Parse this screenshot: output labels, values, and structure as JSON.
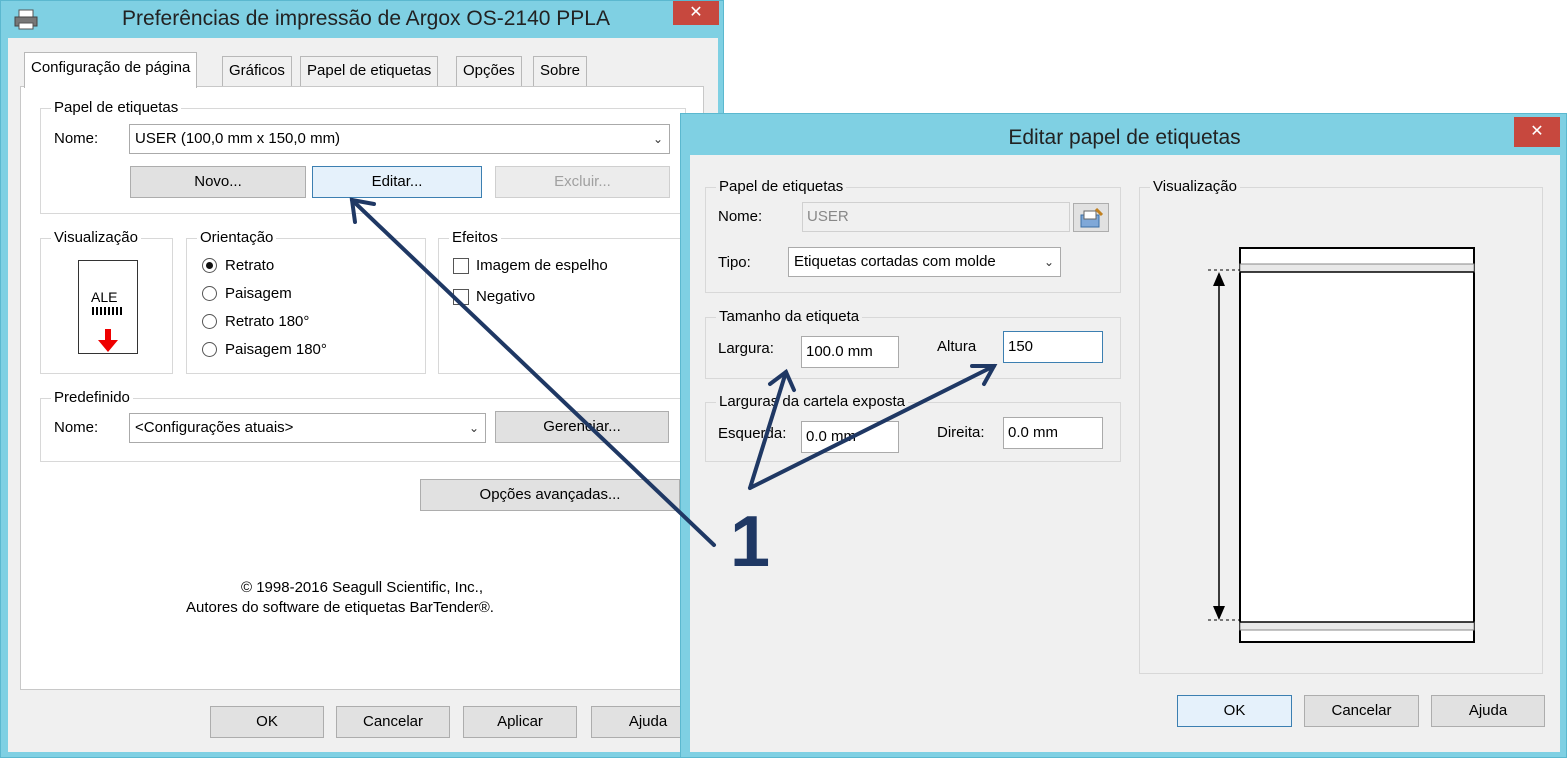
{
  "main_window": {
    "title": "Preferências de impressão de Argox OS-2140 PPLA",
    "close_glyph": "✕",
    "tabs": [
      {
        "label": "Configuração de página",
        "active": true
      },
      {
        "label": "Gráficos"
      },
      {
        "label": "Papel de etiquetas"
      },
      {
        "label": "Opções"
      },
      {
        "label": "Sobre"
      }
    ],
    "paper_group": {
      "label": "Papel de etiquetas",
      "name_label": "Nome:",
      "name_value": "USER (100,0 mm x 150,0 mm)",
      "new_button": "Novo...",
      "edit_button": "Editar...",
      "delete_button": "Excluir..."
    },
    "preview_group": {
      "label": "Visualização",
      "sample_text": "ALE"
    },
    "orientation_group": {
      "label": "Orientação",
      "options": [
        "Retrato",
        "Paisagem",
        "Retrato 180°",
        "Paisagem 180°"
      ],
      "selected": "Retrato"
    },
    "effects_group": {
      "label": "Efeitos",
      "options": [
        "Imagem de espelho",
        "Negativo"
      ]
    },
    "preset_group": {
      "label": "Predefinido",
      "name_label": "Nome:",
      "name_value": "<Configurações atuais>",
      "manage_button": "Gerenciar..."
    },
    "advanced_button": "Opções avançadas...",
    "copyright_line1": "© 1998-2016 Seagull Scientific, Inc.,",
    "copyright_line2": "Autores do software de etiquetas BarTender®.",
    "footer": {
      "ok": "OK",
      "cancel": "Cancelar",
      "apply": "Aplicar",
      "help": "Ajuda"
    }
  },
  "dialog": {
    "title": "Editar papel de etiquetas",
    "close_glyph": "✕",
    "paper_group": {
      "label": "Papel de etiquetas",
      "name_label": "Nome:",
      "name_value": "USER",
      "type_label": "Tipo:",
      "type_value": "Etiquetas cortadas com molde"
    },
    "size_group": {
      "label": "Tamanho da etiqueta",
      "width_label": "Largura:",
      "width_value": "100.0 mm",
      "height_label": "Altura",
      "height_value": "150"
    },
    "liner_group": {
      "label": "Larguras da cartela exposta",
      "left_label": "Esquerda:",
      "left_value": "0.0 mm",
      "right_label": "Direita:",
      "right_value": "0.0 mm"
    },
    "preview_label": "Visualização",
    "footer": {
      "ok": "OK",
      "cancel": "Cancelar",
      "help": "Ajuda"
    }
  },
  "annotation": {
    "number": "1",
    "color": "#1f3864"
  }
}
